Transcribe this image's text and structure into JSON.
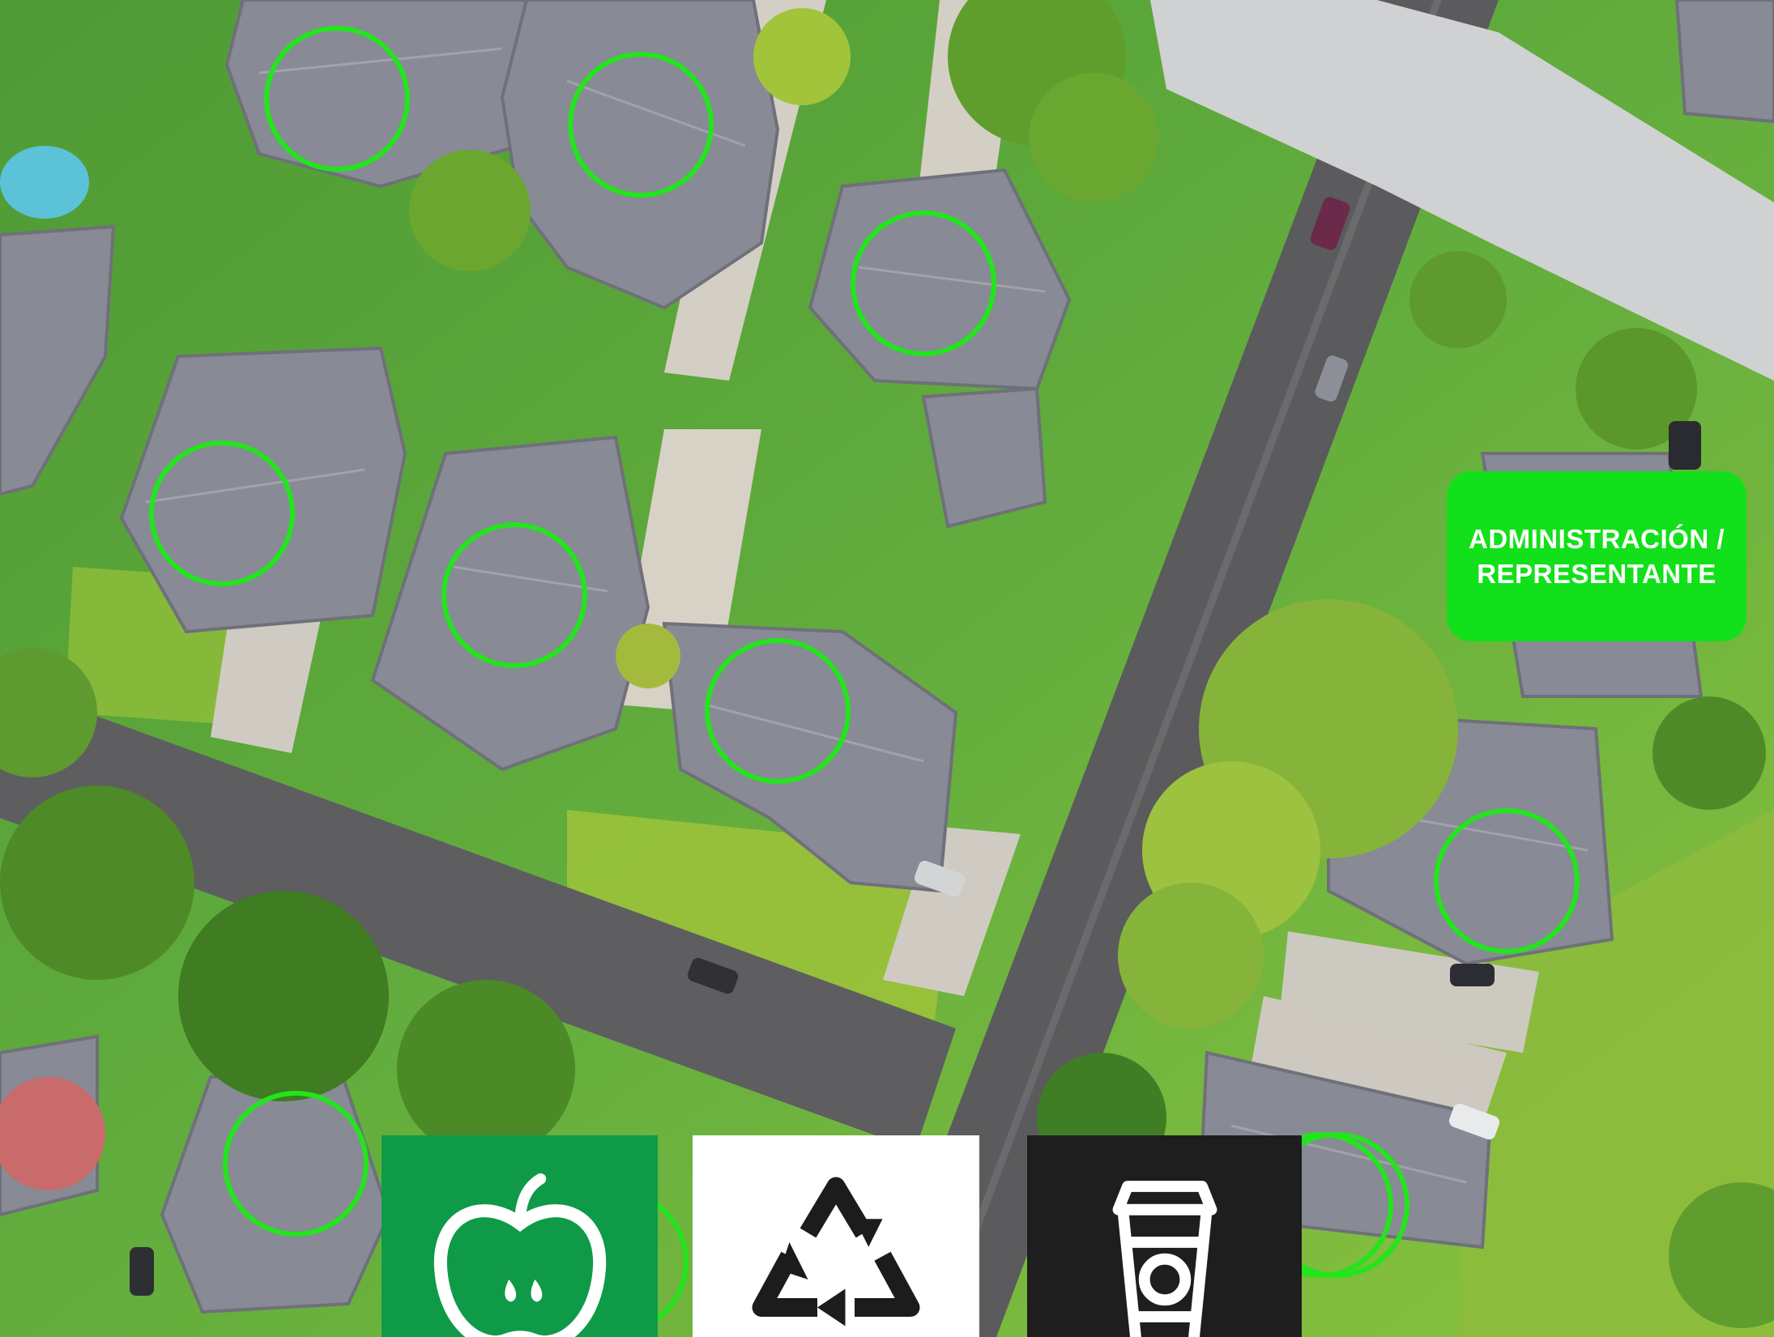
{
  "representative_label": "ADMINISTRACIÓN / REPRESENTANTE",
  "household_markers": [
    {
      "name": "household-marker-1"
    },
    {
      "name": "household-marker-2"
    },
    {
      "name": "household-marker-3"
    },
    {
      "name": "household-marker-4"
    },
    {
      "name": "household-marker-5"
    },
    {
      "name": "household-marker-6"
    },
    {
      "name": "household-marker-7"
    },
    {
      "name": "household-marker-8"
    },
    {
      "name": "household-marker-9"
    },
    {
      "name": "household-marker-10"
    },
    {
      "name": "household-marker-11"
    }
  ],
  "waste_bins": [
    {
      "name": "organic",
      "icon": "apple-icon",
      "background": "#0e9a47",
      "icon_color": "#ffffff"
    },
    {
      "name": "recyclable",
      "icon": "recycle-icon",
      "background": "#ffffff",
      "icon_color": "#1c1c1c"
    },
    {
      "name": "non-recyclable",
      "icon": "disposable-cup-icon",
      "background": "#1e1e1e",
      "icon_color": "#ffffff"
    }
  ],
  "colors": {
    "marker": "#22e51c",
    "label_background": "#12e01a",
    "label_text": "#ffffff",
    "grass": "#5fa53a",
    "road": "#5a5a5c",
    "roof": "#8b8c96"
  }
}
